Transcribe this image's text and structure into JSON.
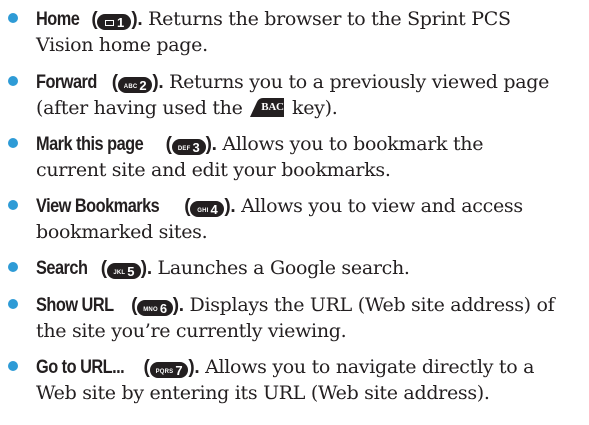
{
  "colors": {
    "bullet": "#2e9bd6",
    "text": "#231f20",
    "key_bg": "#231f20"
  },
  "items": [
    {
      "title": "Home",
      "key": {
        "sub": "",
        "num": "1",
        "icon": "envelope-icon"
      },
      "line1": " Returns the browser to the Sprint PCS",
      "line2": "Vision home page."
    },
    {
      "title": "Forward",
      "key": {
        "sub": "ABC",
        "num": "2"
      },
      "line1": " Returns you to a previously viewed page",
      "line2a": "(after having used the ",
      "back_label": "BACK",
      "line2b": " key)."
    },
    {
      "title": "Mark this page",
      "key": {
        "sub": "DEF",
        "num": "3"
      },
      "line1": " Allows you to bookmark the",
      "line2": "current site and edit your bookmarks."
    },
    {
      "title": "View Bookmarks",
      "key": {
        "sub": "GHI",
        "num": "4"
      },
      "line1": " Allows you to view and access",
      "line2": "bookmarked sites."
    },
    {
      "title": "Search",
      "key": {
        "sub": "JKL",
        "num": "5"
      },
      "line1": " Launches a Google search."
    },
    {
      "title": "Show URL",
      "key": {
        "sub": "MNO",
        "num": "6"
      },
      "line1": " Displays the URL (Web site address) of",
      "line2": "the site you’re currently viewing."
    },
    {
      "title": "Go to URL...",
      "key": {
        "sub": "PQRS",
        "num": "7"
      },
      "line1": " Allows you to navigate directly to a",
      "line2": "Web site by entering its URL (Web site address)."
    }
  ]
}
